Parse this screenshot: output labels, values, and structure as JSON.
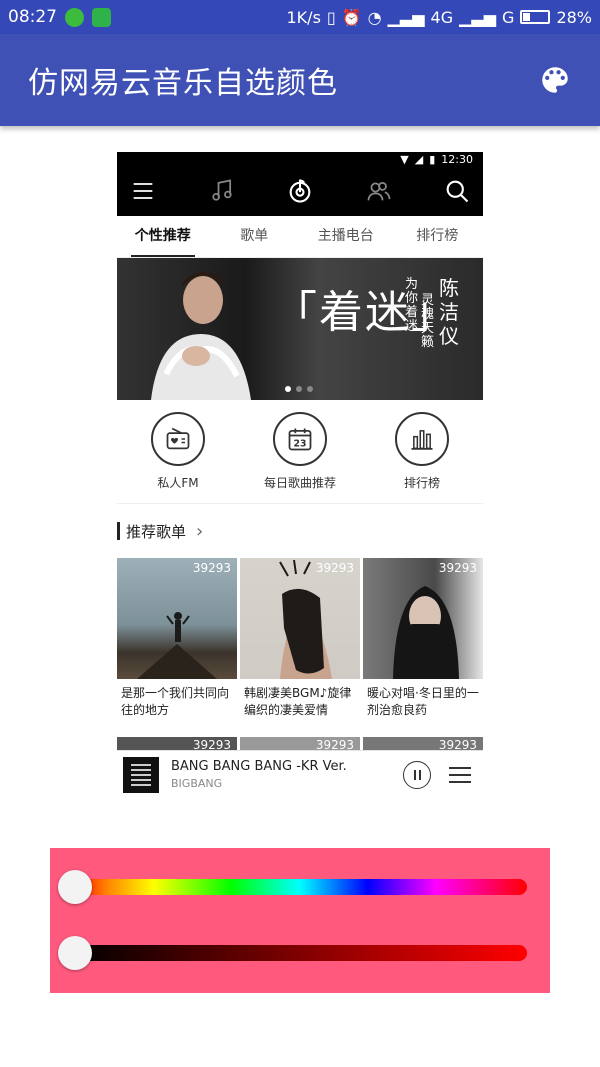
{
  "status_bar": {
    "time": "08:27",
    "network_speed": "1K/s",
    "network_type": "4G",
    "network_type2": "G",
    "battery": "28%"
  },
  "app_bar": {
    "title": "仿网易云音乐自选颜色",
    "action_icon": "palette-icon"
  },
  "preview": {
    "status_time": "12:30",
    "tabs": [
      "个性推荐",
      "歌单",
      "主播电台",
      "排行榜"
    ],
    "active_tab": 0,
    "banner": {
      "big_text": "「着迷」",
      "small_text_1": "为你着迷",
      "small_text_2": "灵魂天籁",
      "artist": "陈洁仪"
    },
    "entries": [
      {
        "label": "私人FM",
        "icon": "radio-icon"
      },
      {
        "label": "每日歌曲推荐",
        "icon": "calendar-icon",
        "day": "23"
      },
      {
        "label": "排行榜",
        "icon": "chart-icon"
      }
    ],
    "section_title": "推荐歌单",
    "cards": [
      {
        "count": "39293",
        "caption": "是那一个我们共同向往的地方"
      },
      {
        "count": "39293",
        "caption": "韩剧凄美BGM♪旋律编织的凄美爱情"
      },
      {
        "count": "39293",
        "caption": "暖心对唱·冬日里的一剂治愈良药"
      }
    ],
    "row2_counts": [
      "39293",
      "39293",
      "39293"
    ],
    "player": {
      "song": "BANG BANG BANG -KR Ver.",
      "artist": "BIGBANG"
    }
  },
  "picker": {
    "background_color": "#ff5a7e",
    "hue_value": 0,
    "shade_value": 0
  }
}
